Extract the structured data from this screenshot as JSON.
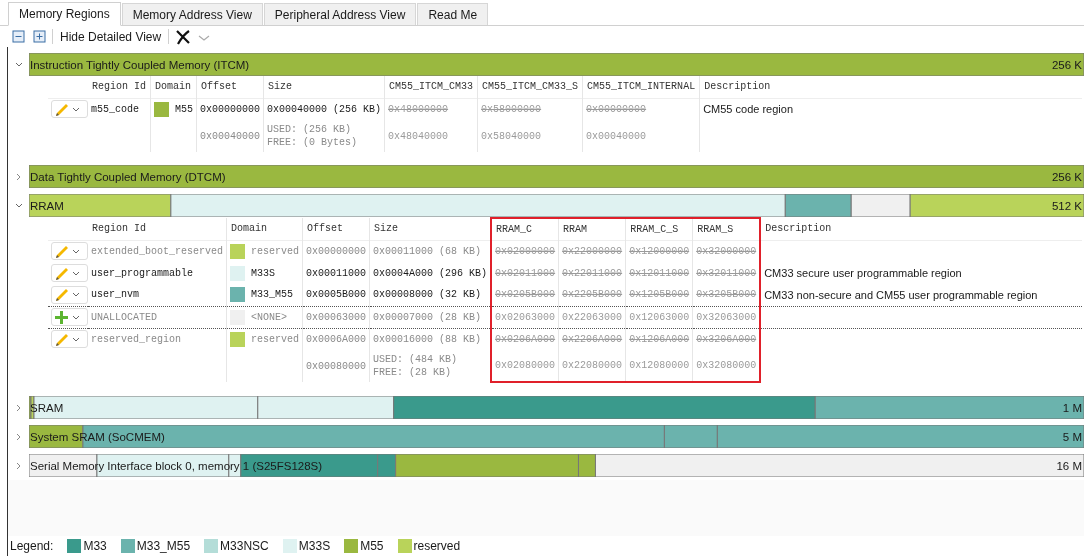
{
  "tabs": [
    {
      "label": "Memory Regions",
      "selected": true
    },
    {
      "label": "Memory Address View",
      "selected": false
    },
    {
      "label": "Peripheral Address View",
      "selected": false
    },
    {
      "label": "Read Me",
      "selected": false
    }
  ],
  "toolbar": {
    "toggle_label": "Hide Detailed View"
  },
  "sections": [
    {
      "title": "Instruction Tightly Coupled Memory (ITCM)",
      "size": "256 K",
      "expanded": true,
      "table": {
        "columns": [
          {
            "label": "Region Id",
            "highlighted": false
          },
          {
            "label": "Domain",
            "highlighted": false
          },
          {
            "label": "Offset",
            "highlighted": false
          },
          {
            "label": "Size",
            "highlighted": false
          },
          {
            "label": "CM55_ITCM_CM33",
            "highlighted": false
          },
          {
            "label": "CM55_ITCM_CM33_S",
            "highlighted": false
          },
          {
            "label": "CM55_ITCM_INTERNAL",
            "highlighted": false
          },
          {
            "label": "Description",
            "highlighted": false
          }
        ],
        "rows": [
          {
            "kind": "region",
            "greyed": false,
            "region_id": "m55_code",
            "domain": "M55",
            "color": "#9ab840",
            "offset": "0x00000000",
            "size": "0x00040000 (256 KB)",
            "struck": true,
            "addresses": [
              "0x48000000",
              "0x58000000",
              "0x00000000"
            ],
            "description": "CM55 code region"
          },
          {
            "kind": "end",
            "offset": "0x00040000",
            "used": "USED: (256 KB)",
            "free": "FREE: (0 Bytes)",
            "addresses": [
              "0x48040000",
              "0x58040000",
              "0x00040000"
            ]
          }
        ]
      }
    },
    {
      "title": "Data Tightly Coupled Memory (DTCM)",
      "size": "256 K",
      "expanded": false
    },
    {
      "title": "RRAM",
      "size": "512 K",
      "expanded": true,
      "table": {
        "columns": [
          {
            "label": "Region Id",
            "highlighted": false
          },
          {
            "label": "Domain",
            "highlighted": false
          },
          {
            "label": "Offset",
            "highlighted": false
          },
          {
            "label": "Size",
            "highlighted": false
          },
          {
            "label": "RRAM_C",
            "highlighted": true
          },
          {
            "label": "RRAM",
            "highlighted": true
          },
          {
            "label": "RRAM_C_S",
            "highlighted": true
          },
          {
            "label": "RRAM_S",
            "highlighted": true
          },
          {
            "label": "Description",
            "highlighted": false
          }
        ],
        "rows": [
          {
            "kind": "region",
            "greyed": true,
            "region_id": "extended_boot_reserved",
            "domain": "reserved",
            "color": "#b9d35a",
            "offset": "0x00000000",
            "size": "0x00011000 (68 KB)",
            "struck": true,
            "addresses": [
              "0x02000000",
              "0x22000000",
              "0x12000000",
              "0x32000000"
            ]
          },
          {
            "kind": "region",
            "greyed": false,
            "region_id": "user_programmable",
            "domain": "M33S",
            "color": "#dff2f1",
            "offset": "0x00011000",
            "size": "0x0004A000 (296 KB)",
            "struck": true,
            "addresses": [
              "0x02011000",
              "0x22011000",
              "0x12011000",
              "0x32011000"
            ],
            "description": "CM33 secure user programmable region"
          },
          {
            "kind": "region",
            "greyed": false,
            "region_id": "user_nvm",
            "domain": "M33_M55",
            "color": "#6bb3ad",
            "offset": "0x0005B000",
            "size": "0x00008000 (32 KB)",
            "struck": true,
            "addresses": [
              "0x0205B000",
              "0x2205B000",
              "0x1205B000",
              "0x3205B000"
            ],
            "description": "CM33 non-secure and CM55 user programmable region"
          },
          {
            "kind": "unallocated",
            "greyed": true,
            "region_id": "UNALLOCATED",
            "domain": "<NONE>",
            "color": "#f0f0f0",
            "offset": "0x00063000",
            "size": "0x00007000 (28 KB)",
            "struck": false,
            "addresses": [
              "0x02063000",
              "0x22063000",
              "0x12063000",
              "0x32063000"
            ]
          },
          {
            "kind": "region",
            "greyed": true,
            "region_id": "reserved_region",
            "domain": "reserved",
            "color": "#b9d35a",
            "offset": "0x0006A000",
            "size": "0x00016000 (88 KB)",
            "struck": true,
            "addresses": [
              "0x0206A000",
              "0x2206A000",
              "0x1206A000",
              "0x3206A000"
            ]
          },
          {
            "kind": "end",
            "offset": "0x00080000",
            "used": "USED: (484 KB)",
            "free": "FREE: (28 KB)",
            "addresses": [
              "0x02080000",
              "0x22080000",
              "0x12080000",
              "0x32080000"
            ]
          }
        ]
      }
    },
    {
      "title": "SRAM",
      "size": "1 M",
      "expanded": false
    },
    {
      "title": "System SRAM (SoCMEM)",
      "size": "5 M",
      "expanded": false
    },
    {
      "title": "Serial Memory Interface block 0, memory 1 (S25FS128S)",
      "size": "16 M",
      "expanded": false
    }
  ],
  "legend": {
    "label": "Legend:",
    "items": [
      {
        "label": "M33",
        "color": "#3a9a8c"
      },
      {
        "label": "M33_M55",
        "color": "#6bb3ad"
      },
      {
        "label": "M33NSC",
        "color": "#b4ddd8"
      },
      {
        "label": "M33S",
        "color": "#dff2f1"
      },
      {
        "label": "M55",
        "color": "#9ab840"
      },
      {
        "label": "reserved",
        "color": "#b9d35a"
      }
    ]
  }
}
